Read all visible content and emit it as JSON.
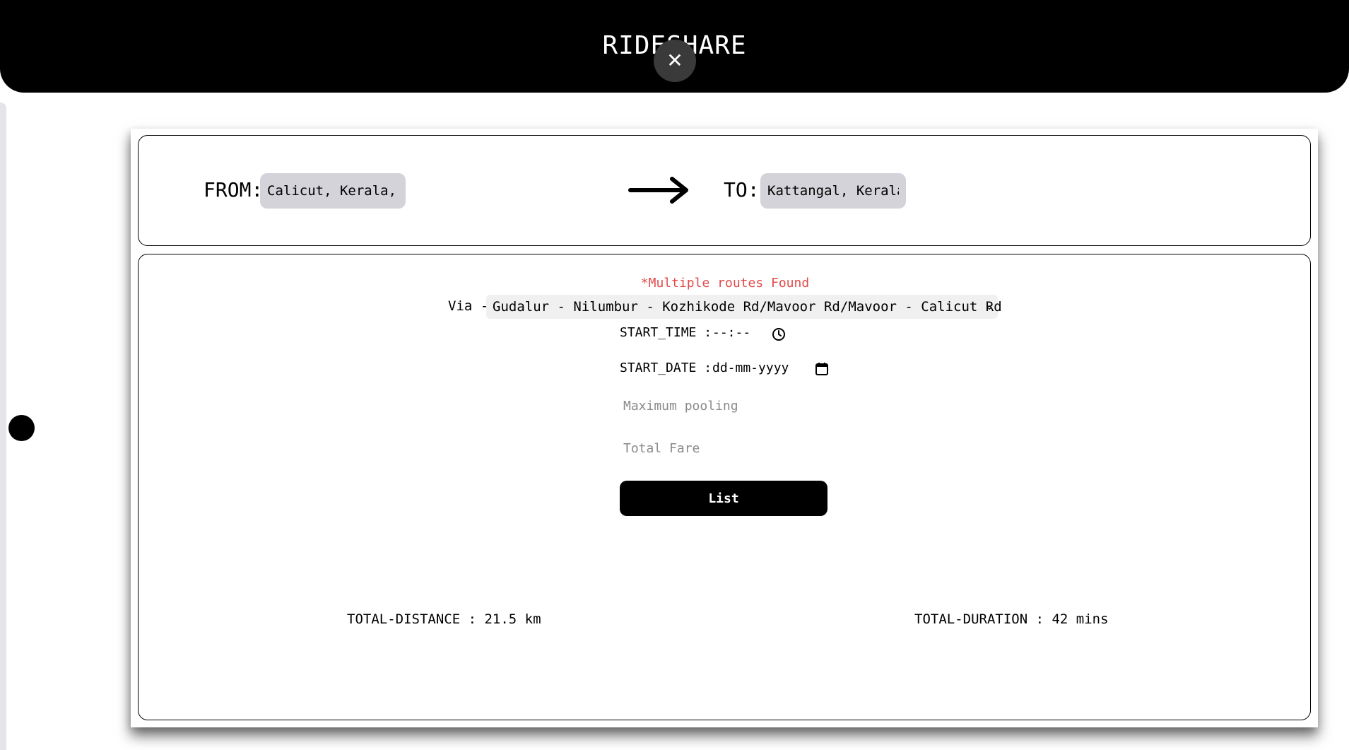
{
  "header": {
    "title": "RIDESHARE",
    "close_symbol": "✕"
  },
  "route": {
    "from_label": "FROM:",
    "from_value": "Calicut, Kerala, Indi",
    "to_label": "TO:",
    "to_value": "Kattangal, Kerala, In",
    "arrow_icon": "right-arrow-icon"
  },
  "details": {
    "notice": "*Multiple routes Found",
    "via_label": "Via -",
    "via_selected": "Gudalur - Nilumbur - Kozhikode Rd/Mavoor Rd/Mavoor - Calicut Rd",
    "start_time_label": "START_TIME :",
    "start_time_value": "--:--",
    "start_date_label": "START_DATE :",
    "start_date_value": "dd-mm-yyyy",
    "max_pooling_placeholder": "Maximum pooling",
    "total_fare_placeholder": "Total Fare",
    "list_button": "List",
    "total_distance": "TOTAL-DISTANCE : 21.5 km",
    "total_duration": "TOTAL-DURATION : 42 mins"
  },
  "colors": {
    "header_bg": "#000000",
    "notice": "#e24a4a",
    "input_bg": "#d3d3d9",
    "button_bg": "#000000"
  }
}
